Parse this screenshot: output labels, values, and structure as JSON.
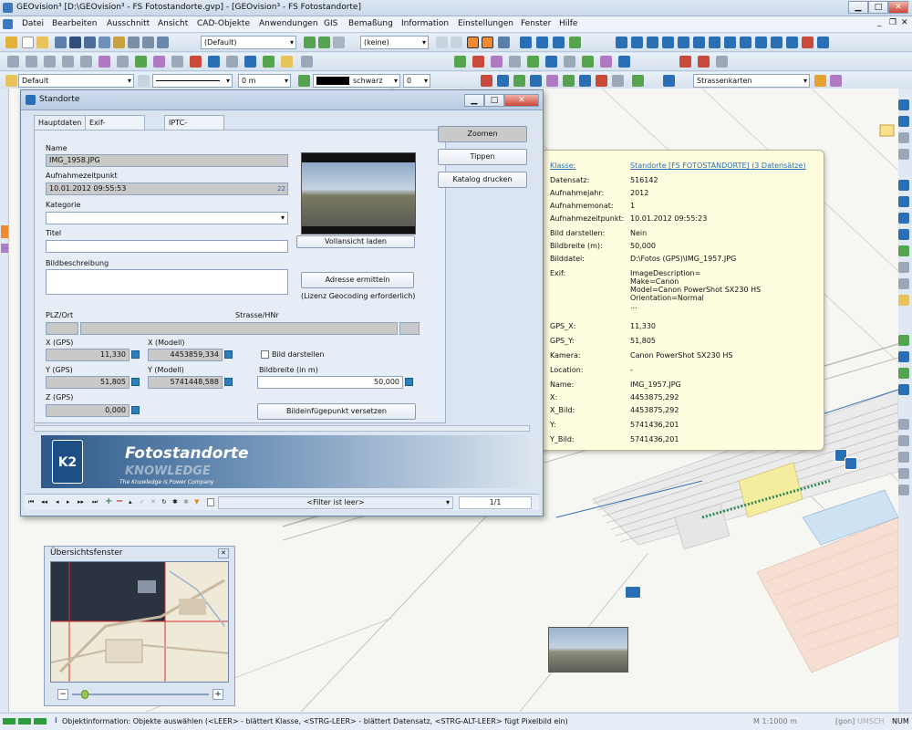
{
  "app": {
    "title": "GEOvision³  [D:\\GEOvision³ - FS Fotostandorte.gvp] - [GEOvision³ - FS Fotostandorte]"
  },
  "menu": [
    "Datei",
    "Bearbeiten",
    "Ausschnitt",
    "Ansicht",
    "CAD-Objekte",
    "Anwendungen",
    "GIS",
    "Bemaßung",
    "Information",
    "Einstellungen",
    "Fenster",
    "Hilfe"
  ],
  "toolbar": {
    "view_combo": "(Default)",
    "layer_combo": "(keine)",
    "style_combo": "Default",
    "distance": "0 m",
    "color_label": "schwarz",
    "width_value": "0",
    "background_combo": "Strassenkarten"
  },
  "dialog": {
    "title": "Standorte",
    "tabs": [
      "Hauptdaten",
      "Exif-Informationen",
      "IPTC-Informationen"
    ],
    "name_label": "Name",
    "name_value": "IMG_1958.JPG",
    "time_label": "Aufnahmezeitpunkt",
    "time_value": "10.01.2012 09:55:53",
    "kategorie_label": "Kategorie",
    "titel_label": "Titel",
    "bild_label": "Bildbeschreibung",
    "plz_label": "PLZ/Ort",
    "strasse_label": "Strasse/HNr",
    "xgps_label": "X (GPS)",
    "xgps_value": "11,330",
    "xmod_label": "X (Modell)",
    "xmod_value": "4453859,334",
    "ygps_label": "Y (GPS)",
    "ygps_value": "51,805",
    "ymod_label": "Y (Modell)",
    "ymod_value": "5741448,588",
    "zgps_label": "Z (GPS)",
    "zgps_value": "0,000",
    "show_image_label": "Bild darstellen",
    "width_label": "Bildbreite (in m)",
    "width_value": "50,000",
    "btn_vollansicht": "Vollansicht laden",
    "btn_adresse": "Adresse ermitteln",
    "lizenz_note": "(Lizenz Geocoding erforderlich)",
    "btn_versetzen": "Bildeinfügepunkt versetzen",
    "btn_zoomen": "Zoomen",
    "btn_tippen": "Tippen",
    "btn_katalog": "Katalog drucken",
    "logo_title": "Fotostandorte",
    "logo_word": "KNOWLEDGE",
    "logo_sub": "The Knowledge is Power Company",
    "logo_brand": "K2",
    "filter": "<Filter ist leer>",
    "record": "1/1"
  },
  "popup": {
    "rows": [
      [
        "Klasse:",
        "Standorte [FS FOTOSTANDORTE] (3 Datensätze)"
      ],
      [
        "Datensatz:",
        "516142"
      ],
      [
        "Aufnahmejahr:",
        "2012"
      ],
      [
        "Aufnahmemonat:",
        "1"
      ],
      [
        "Aufnahmezeitpunkt:",
        "10.01.2012 09:55:23"
      ],
      [
        "Bild darstellen:",
        "Nein"
      ],
      [
        "Bildbreite (m):",
        "50,000"
      ],
      [
        "Bilddatei:",
        "D:\\Fotos (GPS)\\IMG_1957.JPG"
      ],
      [
        "Exif:",
        "ImageDescription=\nMake=Canon\nModel=Canon PowerShot SX230 HS\nOrientation=Normal\n..."
      ],
      [
        "GPS_X:",
        "11,330"
      ],
      [
        "GPS_Y:",
        "51,805"
      ],
      [
        "Kamera:",
        "Canon PowerShot SX230 HS"
      ],
      [
        "Location:",
        "-"
      ],
      [
        "Name:",
        "IMG_1957.JPG"
      ],
      [
        "X:",
        "4453875,292"
      ],
      [
        "X_Bild:",
        "4453875,292"
      ],
      [
        "Y:",
        "5741436,201"
      ],
      [
        "Y_Bild:",
        "5741436,201"
      ]
    ]
  },
  "overview": {
    "title": "Übersichtsfenster"
  },
  "status": {
    "text": "Objektinformation: Objekte auswählen (<LEER> - blättert Klasse, <STRG-LEER> - blättert Datensatz, <STRG-ALT-LEER> fügt Pixelbild ein)",
    "scale": "M 1:1000  m",
    "unit": "[gon]",
    "umsch": "UMSCH",
    "num": "NUM"
  },
  "colors": {
    "accent": "#2a6fb5",
    "popup_bg": "#fffde0",
    "map_bg": "#f6f6f3"
  }
}
